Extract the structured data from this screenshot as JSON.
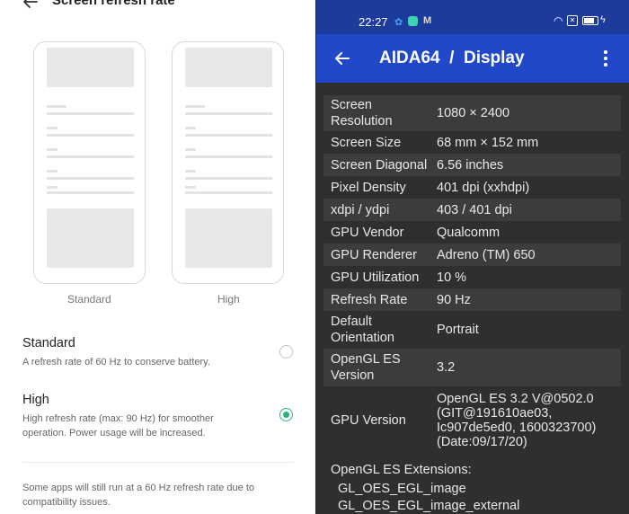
{
  "left": {
    "title": "Screen refresh rate",
    "preview_labels": {
      "standard": "Standard",
      "high": "High"
    },
    "options": [
      {
        "title": "Standard",
        "description": "A refresh rate of 60 Hz to conserve battery.",
        "selected": false
      },
      {
        "title": "High",
        "description": "High refresh rate (max: 90 Hz) for smoother operation. Power usage will be increased.",
        "selected": true
      }
    ],
    "note": "Some apps will still run at a 60 Hz refresh rate due to compatibility issues.",
    "accent_color": "#27b37a"
  },
  "right": {
    "status": {
      "time": "22:27",
      "icons": [
        "settings-icon",
        "app-icon",
        "m-icon",
        "wifi-icon",
        "close-box-icon",
        "battery-icon",
        "charging-icon"
      ]
    },
    "appbar": {
      "title": "AIDA64  /  Display"
    },
    "rows": [
      {
        "label": "Screen Resolution",
        "value": "1080 × 2400"
      },
      {
        "label": "Screen Size",
        "value": "68 mm × 152 mm"
      },
      {
        "label": "Screen Diagonal",
        "value": "6.56 inches"
      },
      {
        "label": "Pixel Density",
        "value": "401 dpi (xxhdpi)"
      },
      {
        "label": "xdpi / ydpi",
        "value": "403 / 401 dpi"
      },
      {
        "label": "GPU Vendor",
        "value": "Qualcomm"
      },
      {
        "label": "GPU Renderer",
        "value": "Adreno (TM) 650"
      },
      {
        "label": "GPU Utilization",
        "value": "10 %"
      },
      {
        "label": "Refresh Rate",
        "value": "90 Hz"
      },
      {
        "label": "Default Orientation",
        "value": "Portrait"
      },
      {
        "label": "OpenGL ES Version",
        "value": "3.2"
      },
      {
        "label": "GPU Version",
        "value": "OpenGL ES 3.2 V@0502.0 (GIT@191610ae03, Ic907de5ed0, 1600323700) (Date:09/17/20)"
      }
    ],
    "extensions_title": "OpenGL ES Extensions:",
    "extensions": [
      "GL_OES_EGL_image",
      "GL_OES_EGL_image_external"
    ],
    "colors": {
      "statusbar": "#1d3b9c",
      "appbar": "#2148c8",
      "background": "#2f2f2f"
    }
  }
}
